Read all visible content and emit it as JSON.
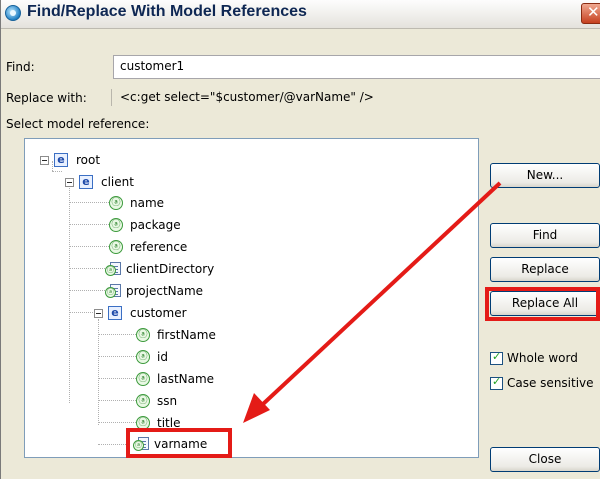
{
  "window": {
    "title": "Find/Replace With Model References"
  },
  "find": {
    "label": "Find:",
    "value": "customer1"
  },
  "replace": {
    "label": "Replace with:",
    "value": "<c:get select=\"$customer/@varName\" />"
  },
  "tree": {
    "label": "Select model reference:",
    "nodes": [
      {
        "label": "root",
        "type": "element"
      },
      {
        "label": "client",
        "type": "element"
      },
      {
        "label": "name",
        "type": "attribute"
      },
      {
        "label": "package",
        "type": "attribute"
      },
      {
        "label": "reference",
        "type": "attribute"
      },
      {
        "label": "clientDirectory",
        "type": "multi-attribute"
      },
      {
        "label": "projectName",
        "type": "multi-attribute"
      },
      {
        "label": "customer",
        "type": "element"
      },
      {
        "label": "firstName",
        "type": "attribute"
      },
      {
        "label": "id",
        "type": "attribute"
      },
      {
        "label": "lastName",
        "type": "attribute"
      },
      {
        "label": "ssn",
        "type": "attribute"
      },
      {
        "label": "title",
        "type": "attribute"
      },
      {
        "label": "varname",
        "type": "multi-attribute"
      }
    ]
  },
  "buttons": {
    "new": "New...",
    "find": "Find",
    "replace": "Replace",
    "replace_all": "Replace All",
    "close": "Close"
  },
  "options": {
    "whole_word": {
      "label": "Whole word",
      "checked": true
    },
    "case_sensitive": {
      "label": "Case sensitive",
      "checked": true
    }
  },
  "icons": {
    "element": "e",
    "attribute": "ⓐ",
    "multi": "ⓐ",
    "close": "✕"
  },
  "colors": {
    "highlight": "#e41b17",
    "title_text": "#0e2753"
  }
}
